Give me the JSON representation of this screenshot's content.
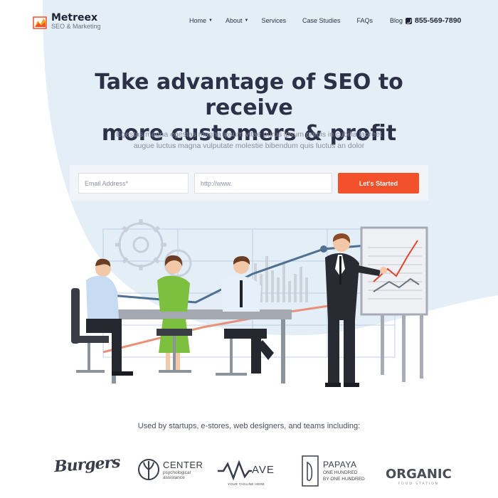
{
  "brand": {
    "name": "Metreex",
    "tagline": "SEO & Marketing"
  },
  "nav": {
    "items": [
      {
        "label": "Home",
        "has_dropdown": true
      },
      {
        "label": "About",
        "has_dropdown": true
      },
      {
        "label": "Services",
        "has_dropdown": false
      },
      {
        "label": "Case Studies",
        "has_dropdown": false
      },
      {
        "label": "FAQs",
        "has_dropdown": false
      },
      {
        "label": "Blog",
        "has_dropdown": false
      }
    ],
    "phone": "855-569-7890"
  },
  "hero": {
    "title_line1": "Take advantage of SEO to receive",
    "title_line2": "more customers & profit",
    "subtitle_line1": "Egestas magna egestas magna ipsum vitae purus ipsum primis in cubilia laoreet",
    "subtitle_line2": "augue luctus magna vulputate molestie bibendum quis luctus an dolor"
  },
  "signup": {
    "email_placeholder": "Email Address*",
    "url_placeholder": "http://www.",
    "button_label": "Let's Started"
  },
  "clients": {
    "heading": "Used by startups, e-stores, web designers, and teams including:",
    "logos": [
      {
        "name": "Burgers"
      },
      {
        "name": "CENTER",
        "sub1": "psychological",
        "sub2": "assistance"
      },
      {
        "name": "AVE",
        "tagline": "YOUR TAGLINE HERE"
      },
      {
        "name": "PAPAYA",
        "sub1": "ONE HUNDRED",
        "sub2": "BY ONE HUNDRED"
      },
      {
        "name": "ORGANIC",
        "tagline": "FOOD STATION"
      }
    ]
  },
  "colors": {
    "accent": "#f2512b",
    "blob": "#e3eef6",
    "text_dark": "#2c3148",
    "text_muted": "#8b8f9e"
  }
}
